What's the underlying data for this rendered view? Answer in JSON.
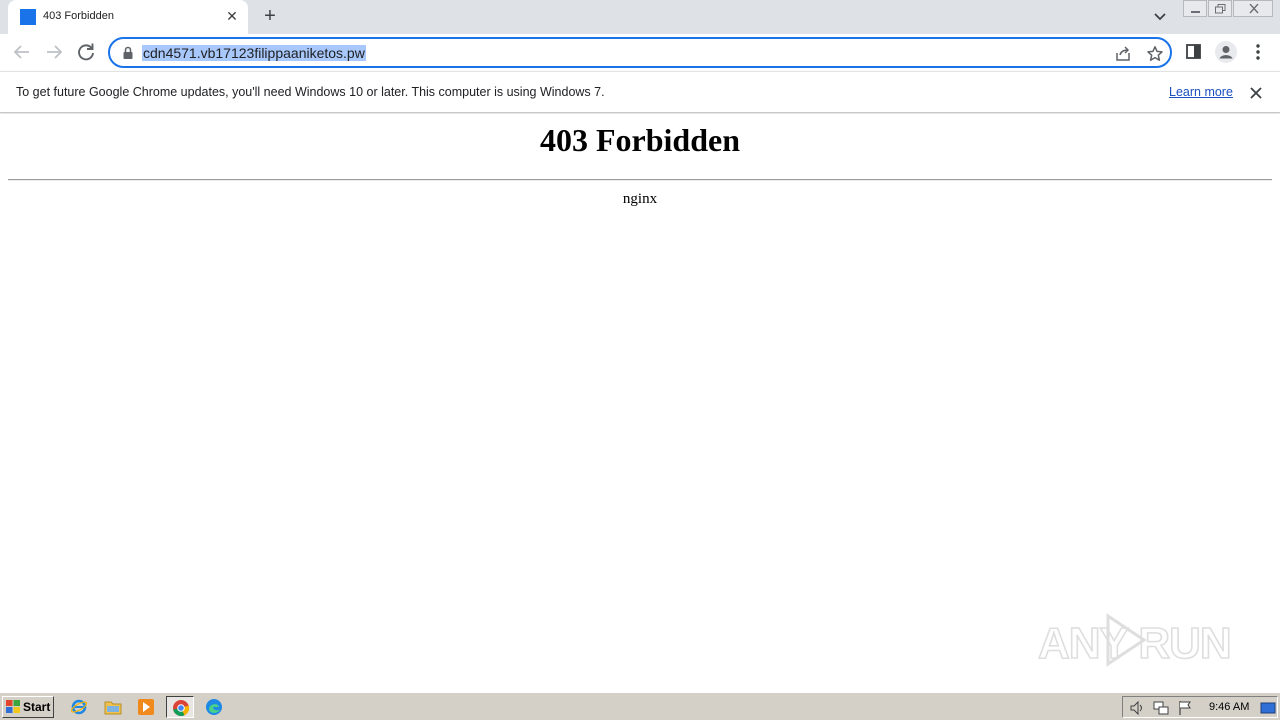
{
  "browser": {
    "tab": {
      "title": "403 Forbidden"
    },
    "omnibox": {
      "url": "cdn4571.vb17123filippaaniketos.pw"
    }
  },
  "infobar": {
    "message": "To get future Google Chrome updates, you'll need Windows 10 or later. This computer is using Windows 7.",
    "link_label": "Learn more"
  },
  "page": {
    "heading": "403 Forbidden",
    "server": "nginx"
  },
  "watermark": {
    "text": "ANY RUN"
  },
  "taskbar": {
    "start_label": "Start",
    "clock": "9:46 AM"
  },
  "colors": {
    "accent": "#1a73e8",
    "url_selection": "#a8c7fa",
    "tabstrip": "#dee1e6",
    "taskbar": "#d4d0c8"
  }
}
